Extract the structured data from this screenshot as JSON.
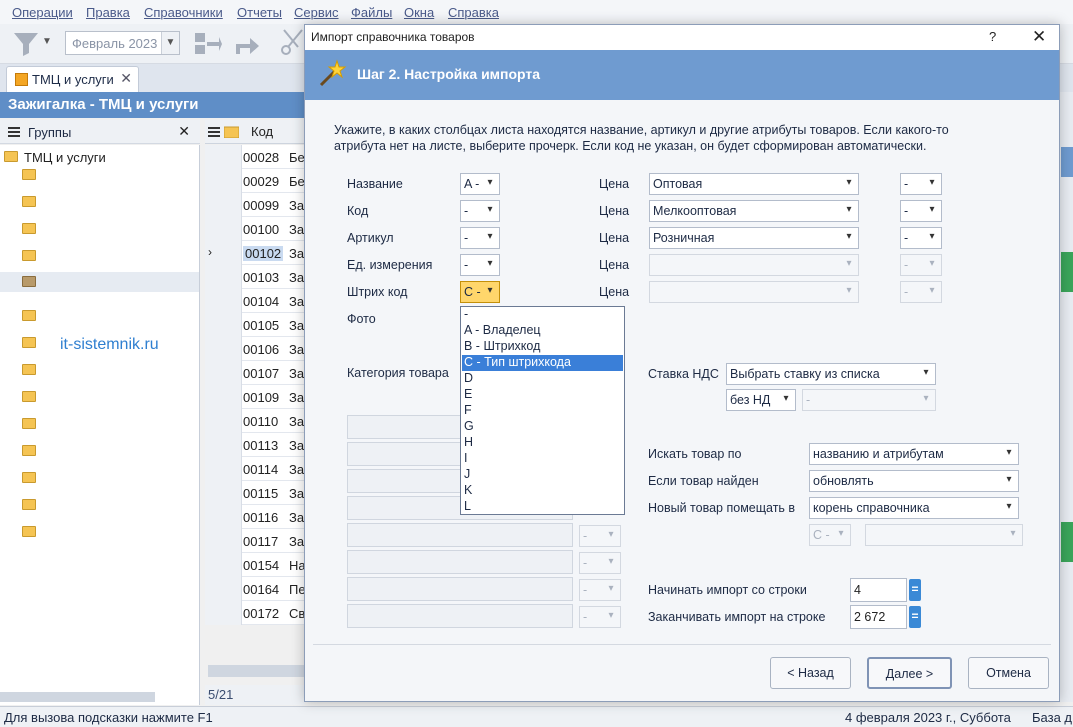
{
  "menu": [
    "Операции",
    "Правка",
    "Справочники",
    "Отчеты",
    "Сервис",
    "Файлы",
    "Окна",
    "Справка"
  ],
  "toolbar": {
    "period": "Февраль 2023"
  },
  "tab": {
    "label": "ТМЦ и услуги"
  },
  "window_title": "Зажигалка - ТМЦ и услуги",
  "groups": {
    "title": "Группы",
    "root": "ТМЦ и услуги"
  },
  "watermark": "it-sistemnik.ru",
  "grid": {
    "header_code": "Код",
    "rows": [
      {
        "code": "00028",
        "name": "Бе"
      },
      {
        "code": "00029",
        "name": "Бе"
      },
      {
        "code": "00099",
        "name": "За"
      },
      {
        "code": "00100",
        "name": "За"
      },
      {
        "code": "00102",
        "name": "За"
      },
      {
        "code": "00103",
        "name": "За"
      },
      {
        "code": "00104",
        "name": "За"
      },
      {
        "code": "00105",
        "name": "За"
      },
      {
        "code": "00106",
        "name": "За"
      },
      {
        "code": "00107",
        "name": "За"
      },
      {
        "code": "00109",
        "name": "За"
      },
      {
        "code": "00110",
        "name": "За"
      },
      {
        "code": "00113",
        "name": "За"
      },
      {
        "code": "00114",
        "name": "За"
      },
      {
        "code": "00115",
        "name": "За"
      },
      {
        "code": "00116",
        "name": "За"
      },
      {
        "code": "00117",
        "name": "За"
      },
      {
        "code": "00154",
        "name": "На"
      },
      {
        "code": "00164",
        "name": "Пе"
      },
      {
        "code": "00172",
        "name": "Св"
      }
    ],
    "counter": "5/21"
  },
  "status": {
    "hint": "Для вызова подсказки нажмите F1",
    "date": "4 февраля 2023 г., Суббота",
    "base": "База д"
  },
  "dialog": {
    "title": "Импорт справочника товаров",
    "help": "?",
    "close": "✕",
    "step": "Шаг 2. Настройка импорта",
    "desc1": "Укажите, в каких столбцах листа находятся название, артикул и другие атрибуты товаров. Если какого-то",
    "desc2": "атрибута нет на листе, выберите прочерк. Если код не указан, он будет сформирован автоматически.",
    "fields": {
      "name_label": "Название",
      "name_val": "A -",
      "code_label": "Код",
      "code_val": "-",
      "article_label": "Артикул",
      "article_val": "-",
      "unit_label": "Ед. измерения",
      "unit_val": "-",
      "barcode_label": "Штрих код",
      "barcode_val": "C -",
      "photo_label": "Фото",
      "category_label": "Категория товара"
    },
    "prices": [
      {
        "label": "Цена",
        "type": "Оптовая",
        "col": "-"
      },
      {
        "label": "Цена",
        "type": "Мелкооптовая",
        "col": "-"
      },
      {
        "label": "Цена",
        "type": "Розничная",
        "col": "-"
      },
      {
        "label": "Цена",
        "type": "",
        "col": "-"
      },
      {
        "label": "Цена",
        "type": "",
        "col": "-"
      }
    ],
    "dropdown": [
      "-",
      "A - Владелец",
      "B - Штрихкод",
      "C - Тип штрихкода",
      "D",
      "E",
      "F",
      "G",
      "H",
      "I",
      "J",
      "K",
      "L"
    ],
    "vat": {
      "label": "Ставка НДС",
      "mode": "Выбрать ставку из списка",
      "rate": "без НД",
      "col": "-"
    },
    "search": {
      "label": "Искать товар по",
      "value": "названию и атрибутам"
    },
    "found": {
      "label": "Если товар найден",
      "value": "обновлять"
    },
    "new_place": {
      "label": "Новый товар помещать в",
      "value": "корень справочника",
      "col": "C -"
    },
    "start": {
      "label": "Начинать импорт со строки",
      "value": "4"
    },
    "end": {
      "label": "Заканчивать импорт на строке",
      "value": "2 672"
    },
    "eq": "=",
    "buttons": {
      "back": "< Назад",
      "next": "Далее >",
      "cancel": "Отмена"
    }
  }
}
